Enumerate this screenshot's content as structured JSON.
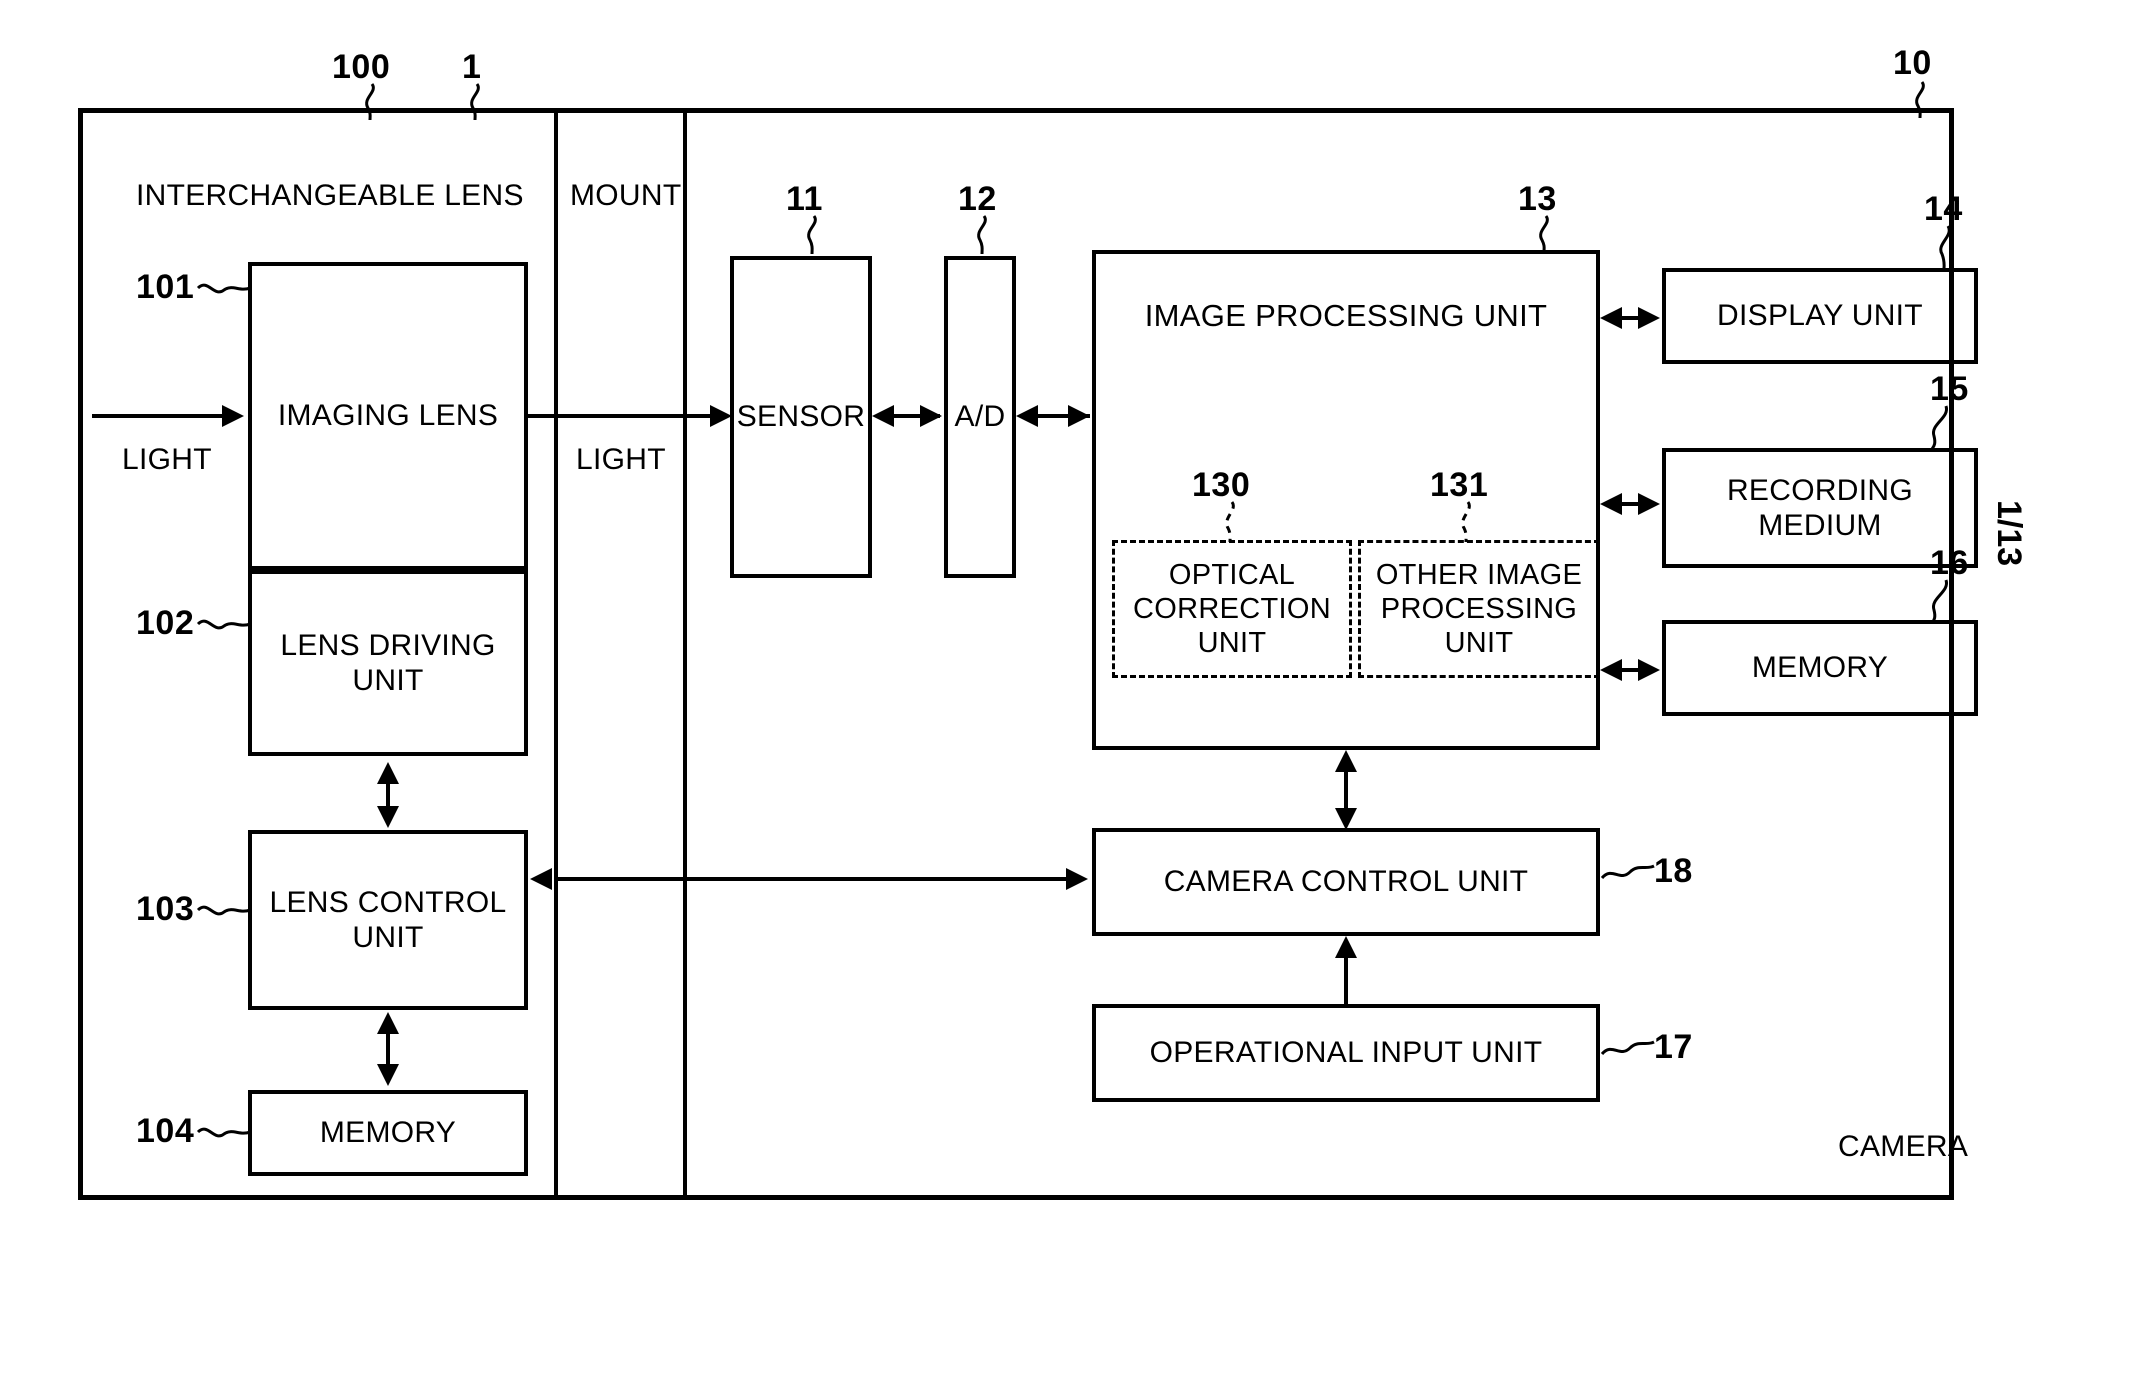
{
  "figure": {
    "page_marker": "1/13",
    "system_ref": "10",
    "system_label": "CAMERA",
    "lens_ref": "100",
    "lens_label": "INTERCHANGEABLE LENS",
    "mount_ref": "1",
    "mount_label": "MOUNT"
  },
  "lens_side": {
    "light_in_label": "LIGHT",
    "blocks": [
      {
        "ref": "101",
        "label": "IMAGING LENS"
      },
      {
        "ref": "102",
        "label": "LENS DRIVING\nUNIT"
      },
      {
        "ref": "103",
        "label": "LENS CONTROL\nUNIT"
      },
      {
        "ref": "104",
        "label": "MEMORY"
      }
    ]
  },
  "mount_side": {
    "light_through_label": "LIGHT"
  },
  "camera_side": {
    "blocks": [
      {
        "ref": "11",
        "label": "SENSOR"
      },
      {
        "ref": "12",
        "label": "A/D"
      },
      {
        "ref": "13",
        "label": "IMAGE PROCESSING UNIT"
      },
      {
        "ref": "14",
        "label": "DISPLAY UNIT"
      },
      {
        "ref": "15",
        "label": "RECORDING\nMEDIUM"
      },
      {
        "ref": "16",
        "label": "MEMORY"
      },
      {
        "ref": "17",
        "label": "OPERATIONAL INPUT UNIT"
      },
      {
        "ref": "18",
        "label": "CAMERA CONTROL UNIT"
      }
    ],
    "image_processing_subunits": [
      {
        "ref": "130",
        "label": "OPTICAL\nCORRECTION\nUNIT"
      },
      {
        "ref": "131",
        "label": "OTHER IMAGE\nPROCESSING\nUNIT"
      }
    ]
  },
  "colors": {
    "ink": "#000000",
    "paper": "#ffffff"
  }
}
